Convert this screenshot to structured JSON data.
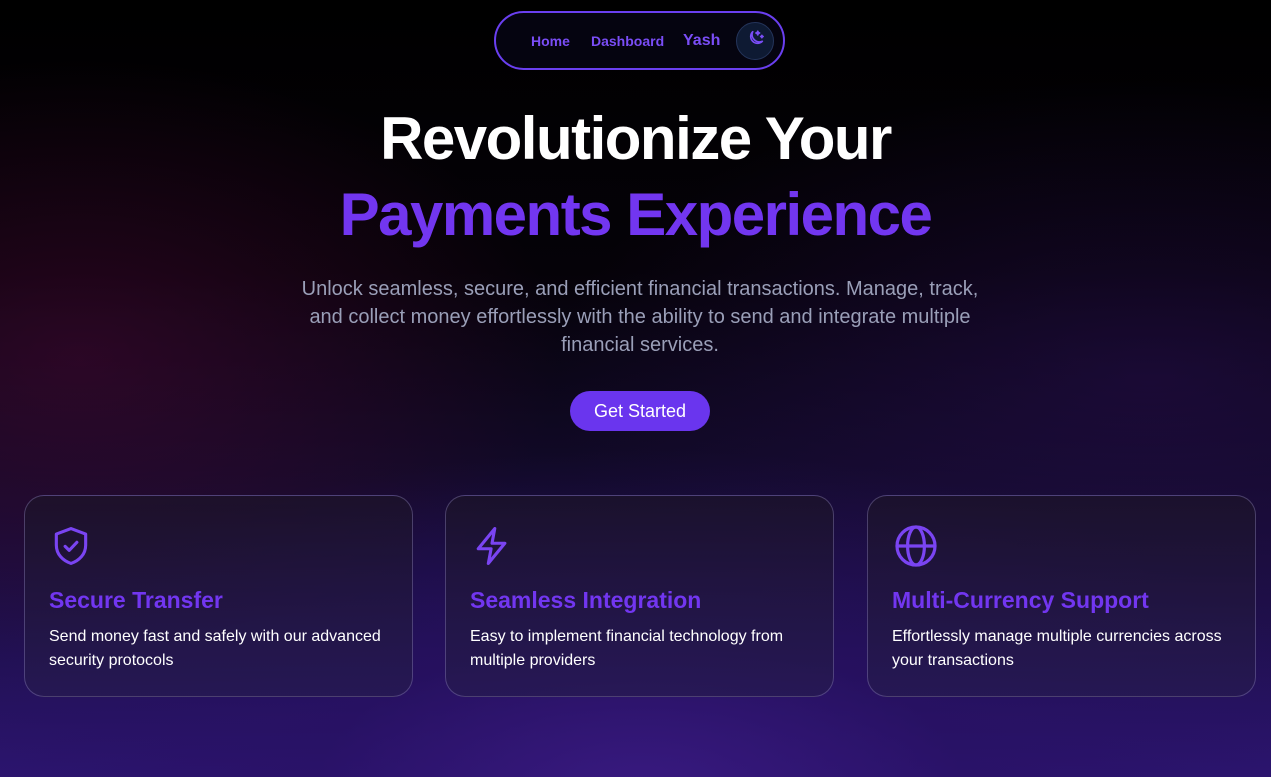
{
  "nav": {
    "home": "Home",
    "dashboard": "Dashboard",
    "user": "Yash",
    "theme_icon": "moon-stars-icon"
  },
  "hero": {
    "title_line1": "Revolutionize Your",
    "title_line2": "Payments Experience",
    "subtitle": "Unlock seamless, secure, and efficient financial transactions. Manage, track, and collect money effortlessly with the ability to send and integrate multiple financial services.",
    "cta": "Get Started"
  },
  "features": [
    {
      "icon": "shield-check-icon",
      "title": "Secure Transfer",
      "description": "Send money fast and safely with our advanced security protocols"
    },
    {
      "icon": "lightning-icon",
      "title": "Seamless Integration",
      "description": "Easy to implement financial technology from multiple providers"
    },
    {
      "icon": "globe-icon",
      "title": "Multi-Currency Support",
      "description": "Effortlessly manage multiple currencies across your transactions"
    }
  ],
  "colors": {
    "accent": "#7236f0",
    "button": "#6a35ee",
    "subtitle": "#9a9fb8"
  }
}
